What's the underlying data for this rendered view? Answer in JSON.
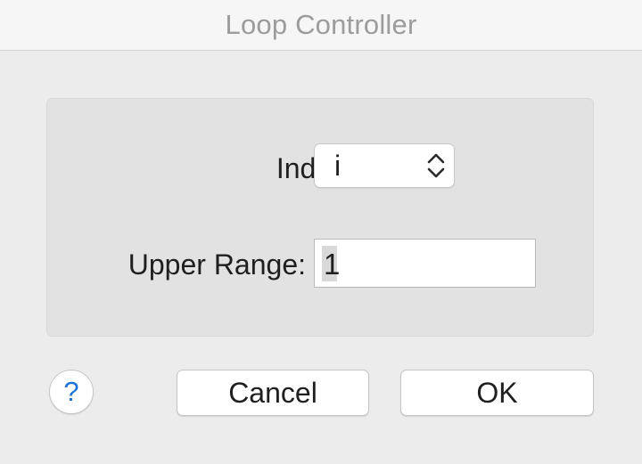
{
  "window": {
    "title": "Loop Controller"
  },
  "form": {
    "index_label": "Index:",
    "index_value": "i",
    "upper_range_label": "Upper Range:",
    "upper_range_value": "1"
  },
  "buttons": {
    "help_label": "?",
    "cancel_label": "Cancel",
    "ok_label": "OK"
  },
  "colors": {
    "help_accent": "#1e73d6",
    "title_text": "#9c9c9c"
  },
  "icons": {
    "popup_arrows": "chevron-up-down-icon"
  }
}
